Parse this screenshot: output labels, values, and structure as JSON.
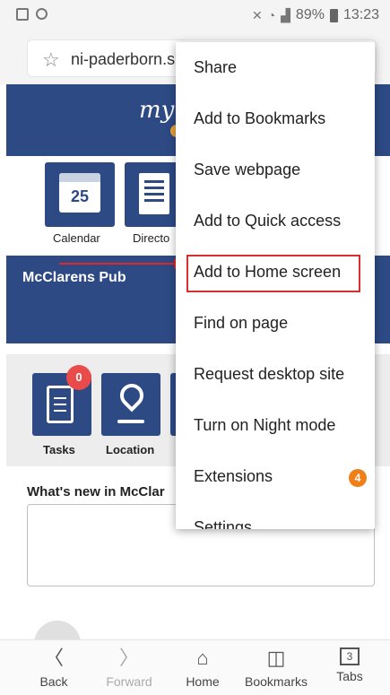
{
  "status_bar": {
    "battery": "89%",
    "time": "13:23"
  },
  "url_bar": {
    "url": "ni-paderborn.s"
  },
  "site": {
    "logo_text": "my",
    "top_icons": [
      {
        "label": "Calendar",
        "number": "25"
      },
      {
        "label": "Directo"
      }
    ],
    "banner_title": "McClarens Pub",
    "bottom_icons": [
      {
        "label": "Tasks",
        "badge": "0"
      },
      {
        "label": "Location"
      }
    ],
    "feed_heading": "What's new in McClar"
  },
  "menu": {
    "items": [
      {
        "label": "Share"
      },
      {
        "label": "Add to Bookmarks"
      },
      {
        "label": "Save webpage"
      },
      {
        "label": "Add to Quick access"
      },
      {
        "label": "Add to Home screen",
        "highlighted": true
      },
      {
        "label": "Find on page"
      },
      {
        "label": "Request desktop site"
      },
      {
        "label": "Turn on Night mode"
      },
      {
        "label": "Extensions",
        "badge": "4"
      },
      {
        "label": "Settings"
      }
    ]
  },
  "bottom_nav": {
    "items": [
      {
        "label": "Back",
        "icon": "chevron-left-icon"
      },
      {
        "label": "Forward",
        "icon": "chevron-right-icon",
        "disabled": true
      },
      {
        "label": "Home",
        "icon": "home-icon"
      },
      {
        "label": "Bookmarks",
        "icon": "book-icon"
      },
      {
        "label": "Tabs",
        "icon": "tabs-icon",
        "count": "3"
      }
    ]
  },
  "colors": {
    "brand_blue": "#2d4a85",
    "highlight_red": "#d62f2f",
    "badge_orange": "#f07f1a",
    "badge_red": "#e94a4a"
  }
}
